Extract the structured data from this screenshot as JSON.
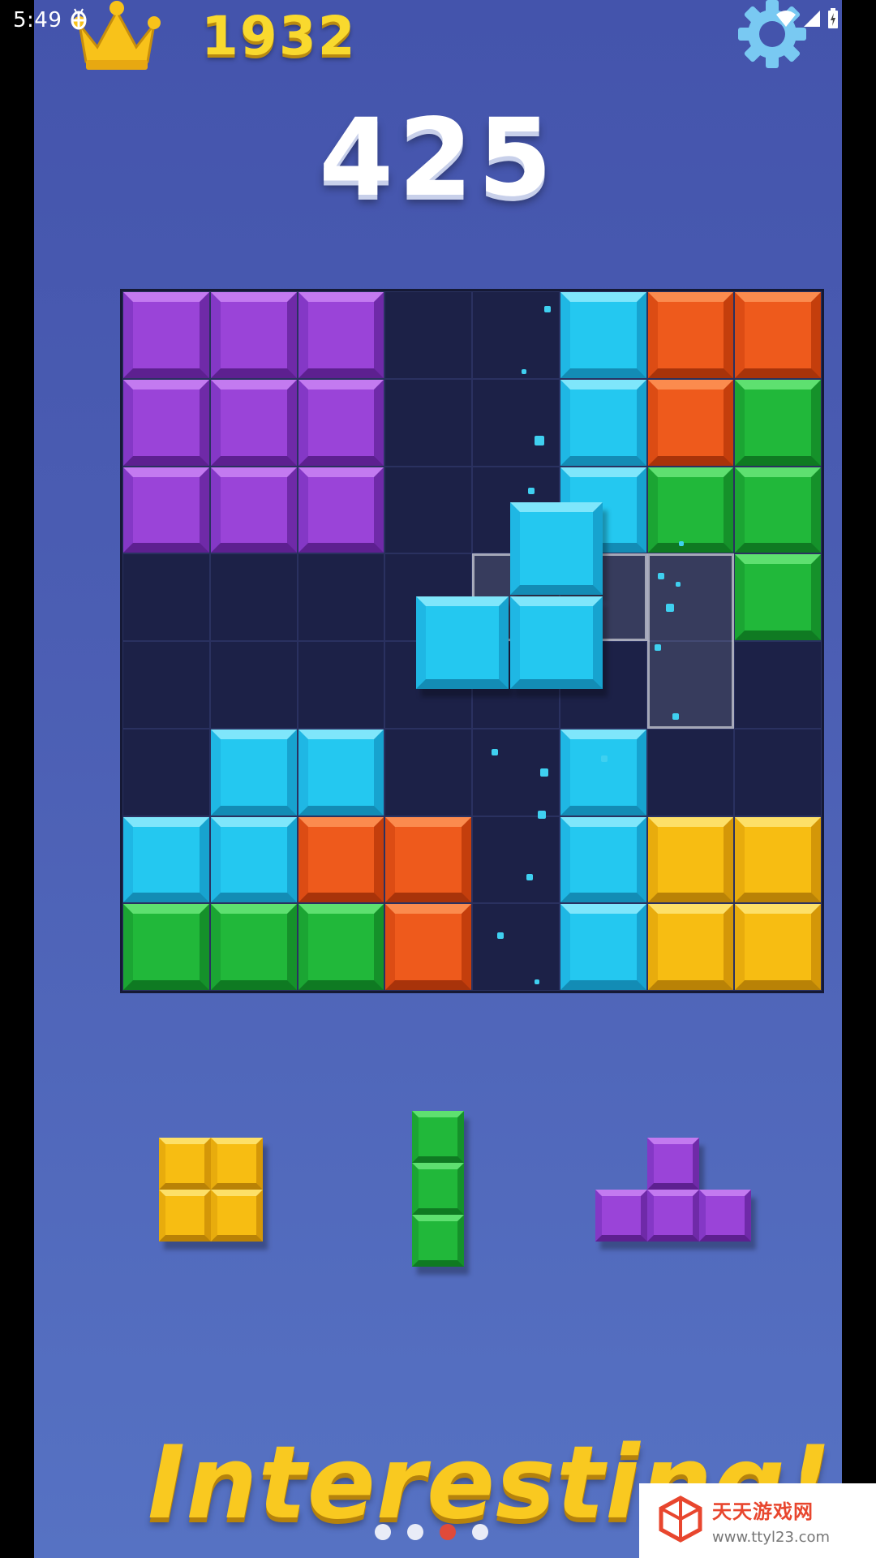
{
  "status_bar": {
    "time": "5:49",
    "icons": [
      "bug-icon",
      "wifi-icon",
      "signal-icon",
      "battery-charging-icon"
    ]
  },
  "header": {
    "best_score": "1932",
    "score": "425",
    "crown_icon": "crown-icon",
    "settings_icon": "gear-icon"
  },
  "board": {
    "rows": 8,
    "cols": 8,
    "grid": [
      [
        "purple",
        "purple",
        "purple",
        "",
        "",
        "cyan",
        "orange",
        "orange"
      ],
      [
        "purple",
        "purple",
        "purple",
        "",
        "",
        "cyan",
        "orange",
        "green"
      ],
      [
        "purple",
        "purple",
        "purple",
        "",
        "",
        "cyan",
        "green",
        "green"
      ],
      [
        "",
        "",
        "",
        "",
        "",
        "",
        "",
        "green"
      ],
      [
        "",
        "",
        "",
        "",
        "",
        "",
        "",
        ""
      ],
      [
        "",
        "cyan",
        "cyan",
        "",
        "",
        "cyan",
        "",
        ""
      ],
      [
        "cyan",
        "cyan",
        "orange",
        "orange",
        "",
        "cyan",
        "yellow",
        "yellow"
      ],
      [
        "green",
        "green",
        "green",
        "orange",
        "",
        "cyan",
        "yellow",
        "yellow"
      ]
    ],
    "dragging_piece": {
      "color": "cyan",
      "shape": "S-tetromino"
    },
    "ghost_preview": {
      "shape": "J"
    }
  },
  "tray": {
    "pieces": [
      {
        "name": "square",
        "color": "yellow",
        "cells": [
          [
            0,
            0
          ],
          [
            1,
            0
          ],
          [
            0,
            1
          ],
          [
            1,
            1
          ]
        ]
      },
      {
        "name": "vertical-line-3",
        "color": "green",
        "cells": [
          [
            0,
            0
          ],
          [
            0,
            1
          ],
          [
            0,
            2
          ]
        ]
      },
      {
        "name": "t-shape",
        "color": "purple",
        "cells": [
          [
            1,
            0
          ],
          [
            0,
            1
          ],
          [
            1,
            1
          ],
          [
            2,
            1
          ]
        ]
      }
    ]
  },
  "tagline": "Interesting!",
  "pagination": {
    "total": 4,
    "active": 2
  },
  "watermark": {
    "title": "天天游戏网",
    "url": "www.ttyl23.com"
  },
  "colors": {
    "background": "#4a5cb2",
    "board": "#1c2147",
    "purple": "#9a44d8",
    "cyan": "#24c8f0",
    "orange": "#ee5a1c",
    "green": "#21b83a",
    "yellow": "#f7bd12",
    "best_score": "#f9d92e",
    "tagline": "#f9c920"
  }
}
